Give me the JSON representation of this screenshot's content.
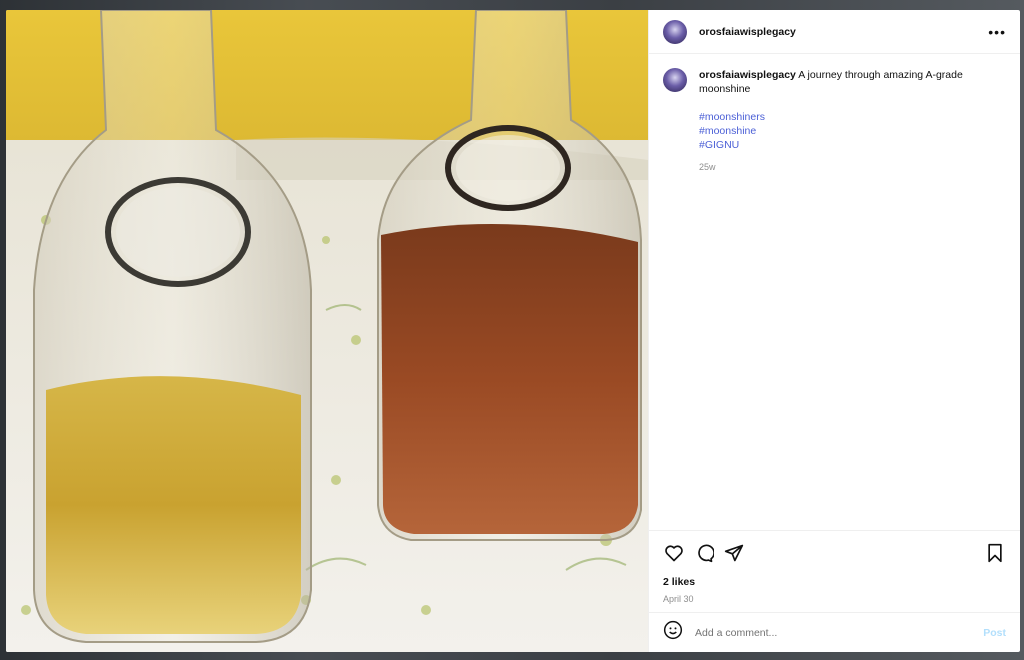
{
  "post": {
    "username": "orosfaiawisplegacy",
    "caption": "A journey through amazing A-grade moonshine",
    "hashtags": [
      "#moonshiners",
      "#moonshine",
      "#GIGNU"
    ],
    "age": "25w",
    "likes": "2 likes",
    "date": "April 30"
  },
  "comment_box": {
    "placeholder": "Add a comment...",
    "post_label": "Post"
  },
  "icons": {
    "more": "more-options-icon",
    "like": "heart-icon",
    "comment": "comment-icon",
    "share": "share-icon",
    "save": "bookmark-icon",
    "emoji": "emoji-icon"
  },
  "colors": {
    "hashtag": "#4b5fd6",
    "post_button": "#b2dffc",
    "muted": "#8e8e8e"
  }
}
